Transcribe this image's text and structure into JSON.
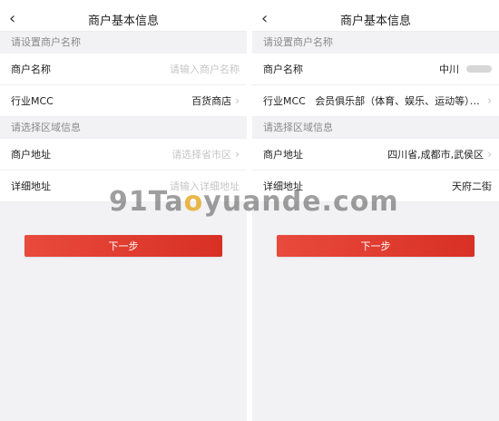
{
  "left": {
    "nav": {
      "back_icon": "chevron-left-icon",
      "title": "商户基本信息"
    },
    "section1": "请设置商户名称",
    "rows1": [
      {
        "label": "商户名称",
        "value": "请输入商户名称",
        "kind": "placeholder"
      },
      {
        "label": "行业MCC",
        "value": "百货商店",
        "kind": "value"
      }
    ],
    "section2": "请选择区域信息",
    "rows2": [
      {
        "label": "商户地址",
        "value": "请选择省市区",
        "kind": "placeholder"
      },
      {
        "label": "详细地址",
        "value": "请输入详细地址",
        "kind": "placeholder"
      }
    ],
    "button": "下一步"
  },
  "right": {
    "nav": {
      "back_icon": "chevron-left-icon",
      "title": "商户基本信息"
    },
    "section1": "请设置商户名称",
    "rows1": [
      {
        "label": "商户名称",
        "value": "中川",
        "kind": "value"
      },
      {
        "label": "行业MCC",
        "value": "会员俱乐部（体育、娱乐、运动等）、乡...",
        "kind": "value"
      }
    ],
    "section2": "请选择区域信息",
    "rows2": [
      {
        "label": "商户地址",
        "value": "四川省,成都市,武侯区",
        "kind": "value"
      },
      {
        "label": "详细地址",
        "value": "天府二街",
        "kind": "value"
      }
    ],
    "button": "下一步"
  },
  "watermark": {
    "prefix": "91Ta",
    "o": "o",
    "suffix": "yuande.com"
  },
  "colors": {
    "accent": "#e03a2e",
    "background": "#f2f2f4",
    "placeholder": "#c6c6c6"
  }
}
